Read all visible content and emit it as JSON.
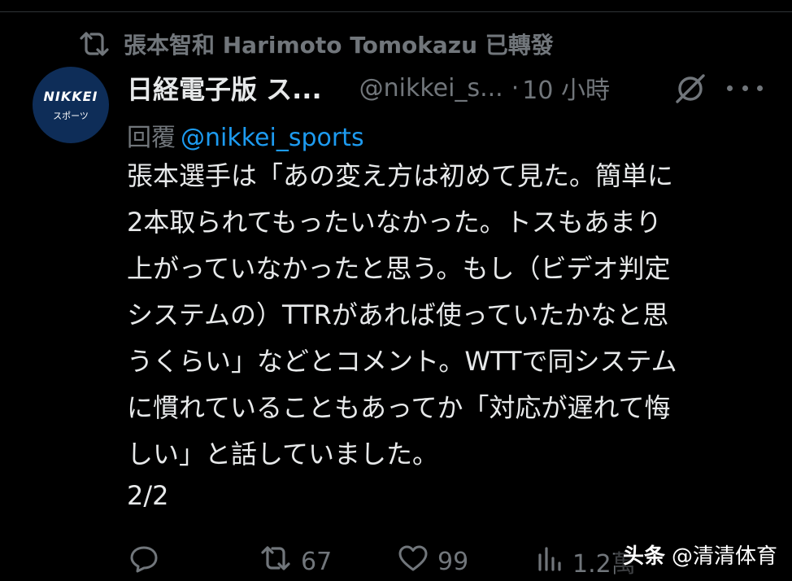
{
  "repost": {
    "label": "張本智和 Harimoto Tomokazu 已轉發",
    "icon": "repost-icon"
  },
  "avatar": {
    "brand": "NIKKEI",
    "sub": "スポーツ",
    "color": "#0e2d58"
  },
  "tweet": {
    "display_name": "日経電子版 ス...",
    "handle": "@nikkei_s...",
    "separator": "·",
    "time": "10 小時",
    "reply_label": "回覆",
    "reply_to": "@nikkei_sports",
    "lines": [
      "張本選手は「あの変え方は初めて見た。簡単に",
      "2本取られてもったいなかった。トスもあまり",
      "上がっていなかったと思う。もし（ビデオ判定",
      "システムの）TTRがあれば使っていたかなと思",
      "うくらい」などとコメント。WTTで同システム",
      "に慣れていることもあってか「対応が遅れて悔",
      "しい」と話していました。"
    ],
    "thread_count": "2/2"
  },
  "actions": {
    "reply": {
      "icon": "comment-icon"
    },
    "repost": {
      "icon": "repost-icon",
      "count": "67"
    },
    "like": {
      "icon": "heart-icon",
      "count": "99"
    },
    "views": {
      "icon": "views-icon",
      "count": "1.2萬"
    }
  },
  "watermark": {
    "brand": "头条",
    "handle": "@清清体育"
  },
  "colors": {
    "background": "#000000",
    "text": "#e7e9ea",
    "muted": "#71767b",
    "accent": "#1d9bf0"
  }
}
